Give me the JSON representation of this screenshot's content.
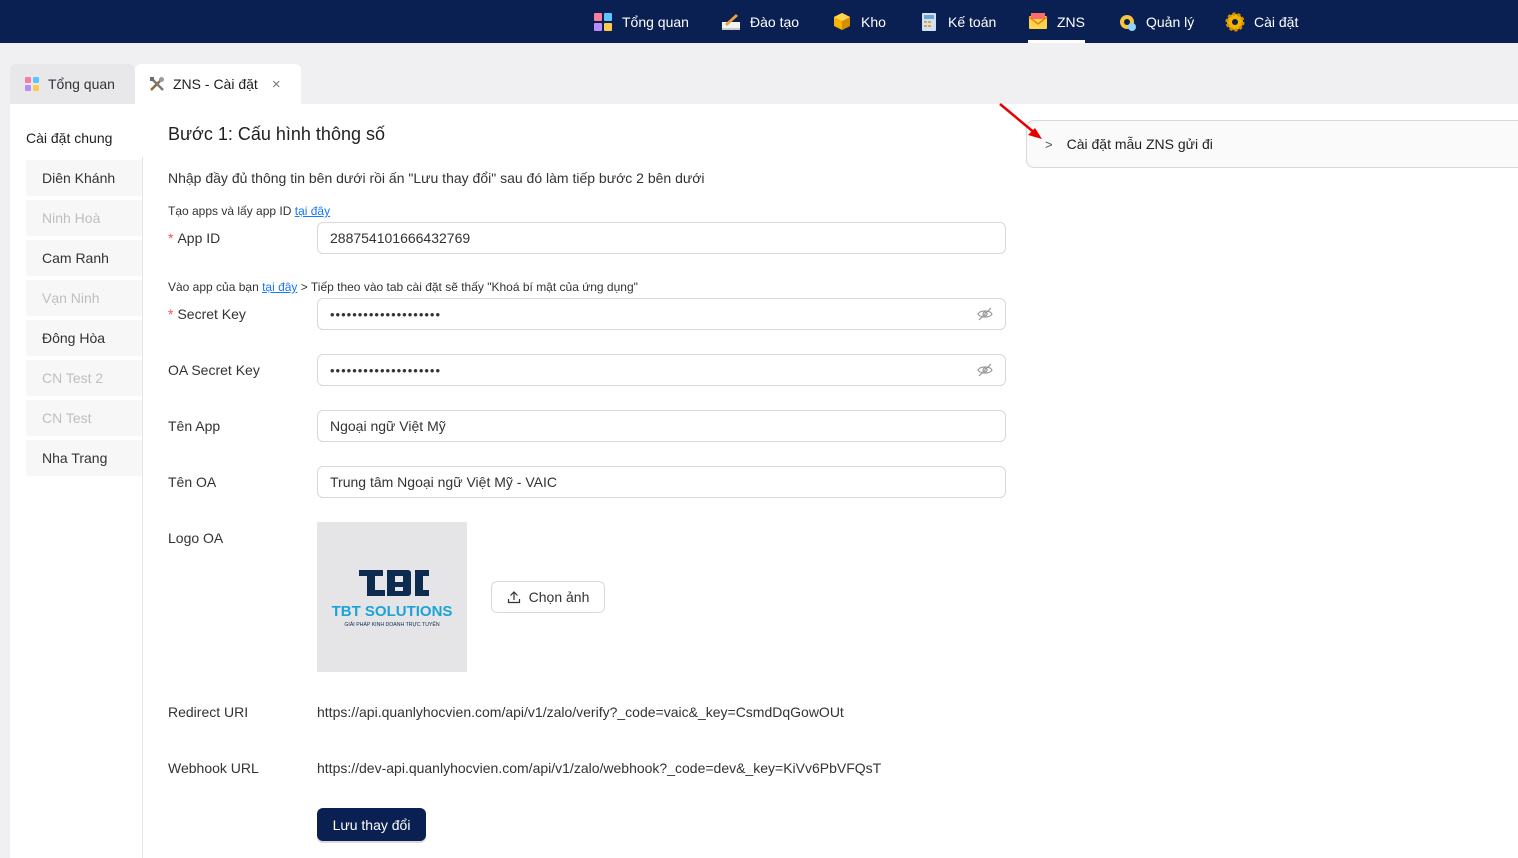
{
  "nav": {
    "items": [
      {
        "label": "Tổng quan",
        "icon": "dashboard-icon"
      },
      {
        "label": "Đào tạo",
        "icon": "training-icon"
      },
      {
        "label": "Kho",
        "icon": "warehouse-icon"
      },
      {
        "label": "Kế toán",
        "icon": "accounting-icon"
      },
      {
        "label": "ZNS",
        "icon": "zns-mail-icon"
      },
      {
        "label": "Quản lý",
        "icon": "management-icon"
      },
      {
        "label": "Cài đặt",
        "icon": "settings-gear-icon"
      }
    ],
    "active": "ZNS",
    "background": "#0a1f52"
  },
  "tabs": [
    {
      "label": "Tổng quan",
      "icon": "dashboard-icon"
    },
    {
      "label": "ZNS - Cài đặt",
      "icon": "tools-icon",
      "close": "×"
    }
  ],
  "sidebar": {
    "heading": "Cài đặt chung",
    "items": [
      {
        "label": "Diên Khánh",
        "enabled": true
      },
      {
        "label": "Ninh Hoà",
        "enabled": false
      },
      {
        "label": "Cam Ranh",
        "enabled": true
      },
      {
        "label": "Vạn Ninh",
        "enabled": false
      },
      {
        "label": "Đông Hòa",
        "enabled": true
      },
      {
        "label": "CN Test 2",
        "enabled": false
      },
      {
        "label": "CN Test",
        "enabled": false
      },
      {
        "label": "Nha Trang",
        "enabled": true
      }
    ]
  },
  "form": {
    "title": "Bước 1: Cấu hình thông số",
    "description": "Nhập đầy đủ thông tin bên dưới rồi ấn \"Lưu thay đổi\" sau đó làm tiếp bước 2 bên dưới",
    "hint_app_prefix": "Tạo apps và lấy app ID ",
    "hint_app_link": "tại đây",
    "hint_secret_prefix": "Vào app của bạn ",
    "hint_secret_link": "tại đây",
    "hint_secret_suffix": " > Tiếp theo vào tab cài đặt sẽ thấy \"Khoá bí mật của ứng dụng\"",
    "required_mark": "*",
    "app_id": {
      "label": "App ID",
      "value": "288754101666432769"
    },
    "secret_key": {
      "label": "Secret Key",
      "value": "••••••••••••••••••••"
    },
    "oa_secret_key": {
      "label": "OA Secret Key",
      "value": "••••••••••••••••••••"
    },
    "app_name": {
      "label": "Tên App",
      "value": "Ngoại ngữ Việt Mỹ"
    },
    "oa_name": {
      "label": "Tên OA",
      "value": "Trung tâm Ngoại ngữ Việt Mỹ - VAIC"
    },
    "logo": {
      "label": "Logo OA",
      "brand": "TBT SOLUTIONS",
      "tagline": "GIẢI PHÁP KINH DOANH TRỰC TUYẾN",
      "mark": "tbt-logo"
    },
    "upload_label": "Chọn ảnh",
    "redirect": {
      "label": "Redirect URI",
      "value": "https://api.quanlyhocvien.com/api/v1/zalo/verify?_code=vaic&_key=CsmdDqGowOUt"
    },
    "webhook": {
      "label": "Webhook URL",
      "value": "https://dev-api.quanlyhocvien.com/api/v1/zalo/webhook?_code=dev&_key=KiVv6PbVFQsT"
    },
    "save_label": "Lưu thay đổi"
  },
  "panel": {
    "chevron": ">",
    "title": "Cài đặt mẫu ZNS gửi đi"
  },
  "colors": {
    "primary": "#0a1f52",
    "link": "#1677ff",
    "required": "#ff4d4f",
    "annotation_arrow": "#e60000"
  }
}
